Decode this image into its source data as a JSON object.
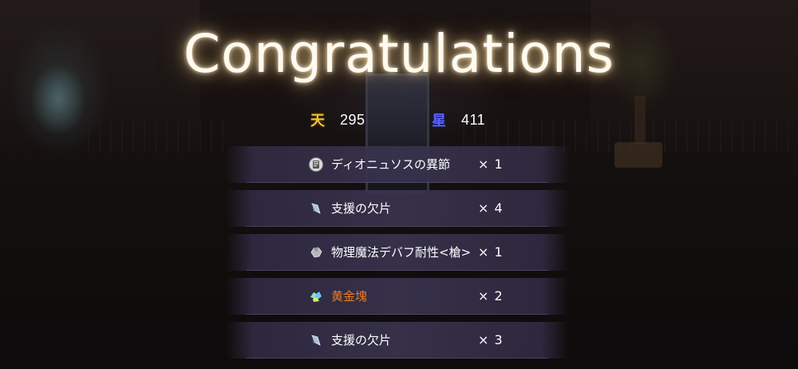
{
  "title": "Congratulations",
  "currencies": [
    {
      "icon": "天",
      "icon_name": "gold-currency-icon",
      "color": "#f3c23a",
      "value": "295"
    },
    {
      "icon": "星",
      "icon_name": "blue-currency-icon",
      "color": "#5d63ff",
      "value": "411"
    }
  ],
  "rewards": [
    {
      "icon": "book-icon",
      "name": "ディオニュソスの異節",
      "quantity": "× 1",
      "rare": false
    },
    {
      "icon": "shard-icon",
      "name": "支援の欠片",
      "quantity": "× 4",
      "rare": false
    },
    {
      "icon": "stone-icon",
      "name": "物理魔法デバフ耐性<槍>",
      "quantity": "× 1",
      "rare": false
    },
    {
      "icon": "gold-ore-icon",
      "name": "黄金塊",
      "quantity": "× 2",
      "rare": true
    },
    {
      "icon": "shard-icon",
      "name": "支援の欠片",
      "quantity": "× 3",
      "rare": false
    }
  ],
  "colors": {
    "rare_item": "#f07a1e",
    "title_glow": "#ffdca0"
  }
}
